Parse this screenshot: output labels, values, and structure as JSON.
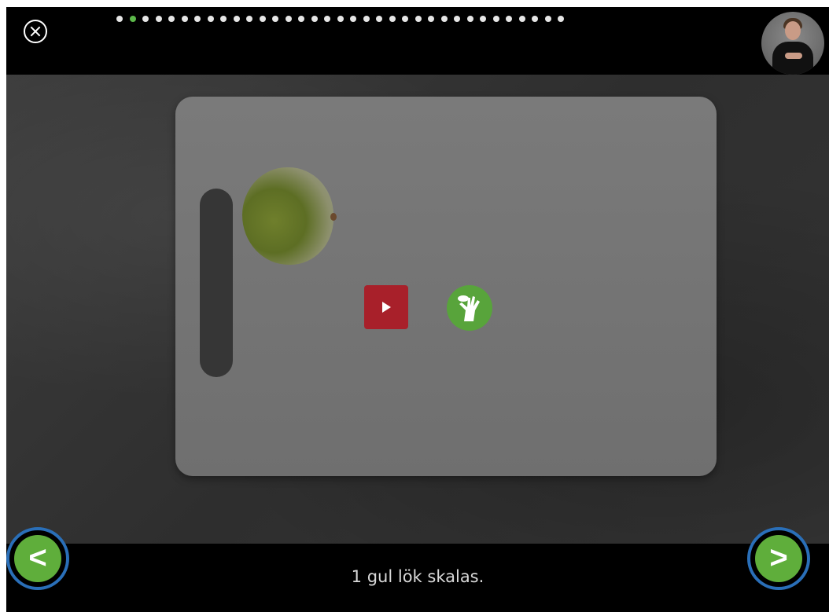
{
  "caption": "1 gul lök skalas.",
  "progress": {
    "total_steps": 35,
    "current_step": 2
  },
  "nav": {
    "prev_label": "<",
    "next_label": ">"
  },
  "colors": {
    "accent_green": "#5fae3b",
    "play_red": "#a8202a",
    "highlight_ring": "#2a6fb8"
  },
  "icons": {
    "close": "close-icon",
    "play": "play-icon",
    "sign_language": "sign-language-hand-icon",
    "signer": "sign-language-interpreter-avatar"
  }
}
